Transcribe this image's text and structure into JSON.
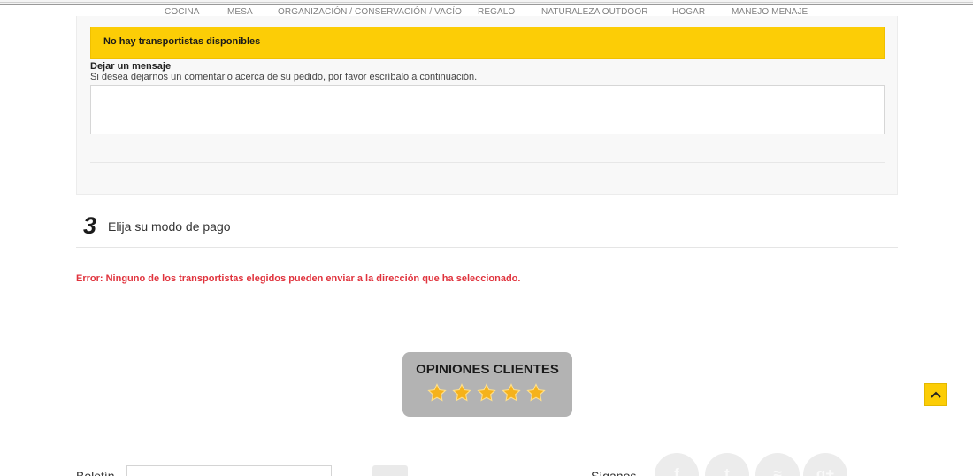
{
  "menu": {
    "items": [
      "COCINA",
      "MESA",
      "ORGANIZACIÓN / CONSERVACIÓN / VACÍO",
      "REGALO",
      "NATURALEZA OUTDOOR",
      "HOGAR",
      "MANEJO MENAJE"
    ]
  },
  "carrier": {
    "alert": "No hay transportistas disponibles",
    "message_title": "Dejar un mensaje",
    "message_help": "Si desea dejarnos un comentario acerca de su pedido, por favor escríbalo a continuación.",
    "message_value": ""
  },
  "payment": {
    "step_number": "3",
    "step_label": "Elija su modo de pago",
    "error": "Error: Ninguno de los transportistas elegidos pueden enviar a la dirección que ha seleccionado."
  },
  "reviews": {
    "title": "OPINIONES CLIENTES",
    "rating": 5,
    "max_rating": 5,
    "star_color": "#f5b21b"
  },
  "footer": {
    "newsletter_label": "Boletín",
    "newsletter_value": "",
    "follow_label": "Síganos",
    "social_icons": [
      "facebook-icon",
      "twitter-icon",
      "rss-icon",
      "google-plus-icon"
    ]
  },
  "colors": {
    "accent": "#fccd06",
    "error": "#e0333d"
  },
  "icons": {
    "scroll_top": "chevron-up-icon"
  }
}
